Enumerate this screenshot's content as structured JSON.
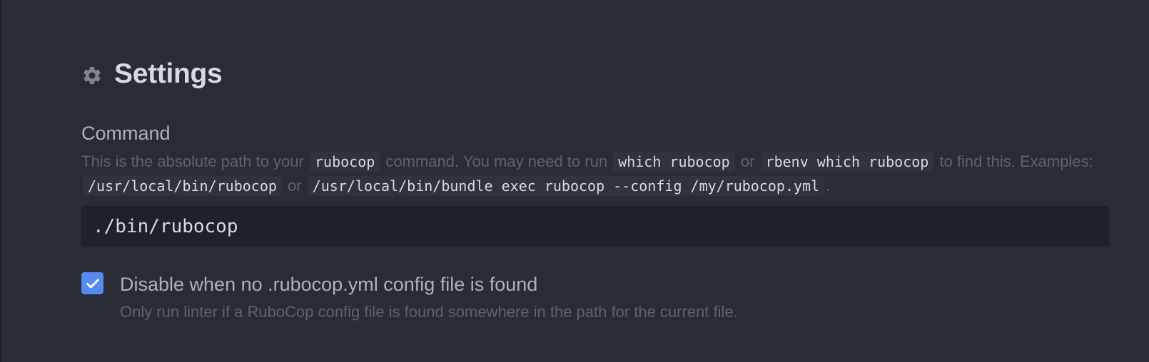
{
  "section": {
    "title": "Settings",
    "icon": "gear-icon"
  },
  "command_setting": {
    "title": "Command",
    "description": {
      "part1": "This is the absolute path to your",
      "code1": "rubocop",
      "part2": "command. You may need to run",
      "code2": "which rubocop",
      "part3": "or",
      "code3": "rbenv which rubocop",
      "part4": "to find this. Examples:",
      "code4": "/usr/local/bin/rubocop",
      "part5": "or",
      "code5": "/usr/local/bin/bundle exec rubocop --config /my/rubocop.yml",
      "part6": "."
    },
    "value": "./bin/rubocop"
  },
  "disable_setting": {
    "checked": true,
    "label": "Disable when no .rubocop.yml config file is found",
    "description": "Only run linter if a RuboCop config file is found somewhere in the path for the current file."
  },
  "colors": {
    "background": "#282c34",
    "input_background": "#1e2127",
    "accent": "#568af2",
    "text": "#abb2bf",
    "muted": "#5c6370"
  }
}
